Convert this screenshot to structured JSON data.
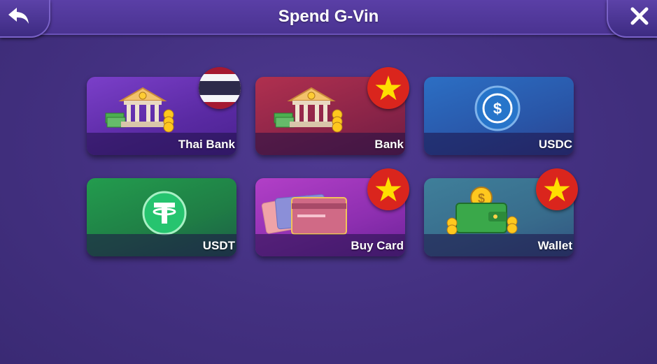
{
  "header": {
    "title": "Spend G-Vin",
    "back_icon": "back-arrow-icon",
    "close_icon": "close-icon"
  },
  "options": [
    {
      "label": "Thai Bank",
      "icon": "bank-building-icon",
      "flag": "thailand-flag",
      "color": "#6a34b8"
    },
    {
      "label": "Bank",
      "icon": "bank-building-icon",
      "flag": "vietnam-flag",
      "color": "#8a2448"
    },
    {
      "label": "USDC",
      "icon": "usdc-coin-icon",
      "flag": null,
      "color": "#2956a8"
    },
    {
      "label": "USDT",
      "icon": "tether-coin-icon",
      "flag": null,
      "color": "#1f7d45"
    },
    {
      "label": "Buy Card",
      "icon": "cards-icon",
      "flag": "vietnam-flag",
      "color": "#8d2fb0"
    },
    {
      "label": "Wallet",
      "icon": "wallet-icon",
      "flag": "vietnam-flag",
      "color": "#386c8c"
    }
  ],
  "colors": {
    "background": "#433080",
    "header": "#4a3391",
    "vietnam_red": "#da251d",
    "vietnam_star": "#ffde00"
  }
}
